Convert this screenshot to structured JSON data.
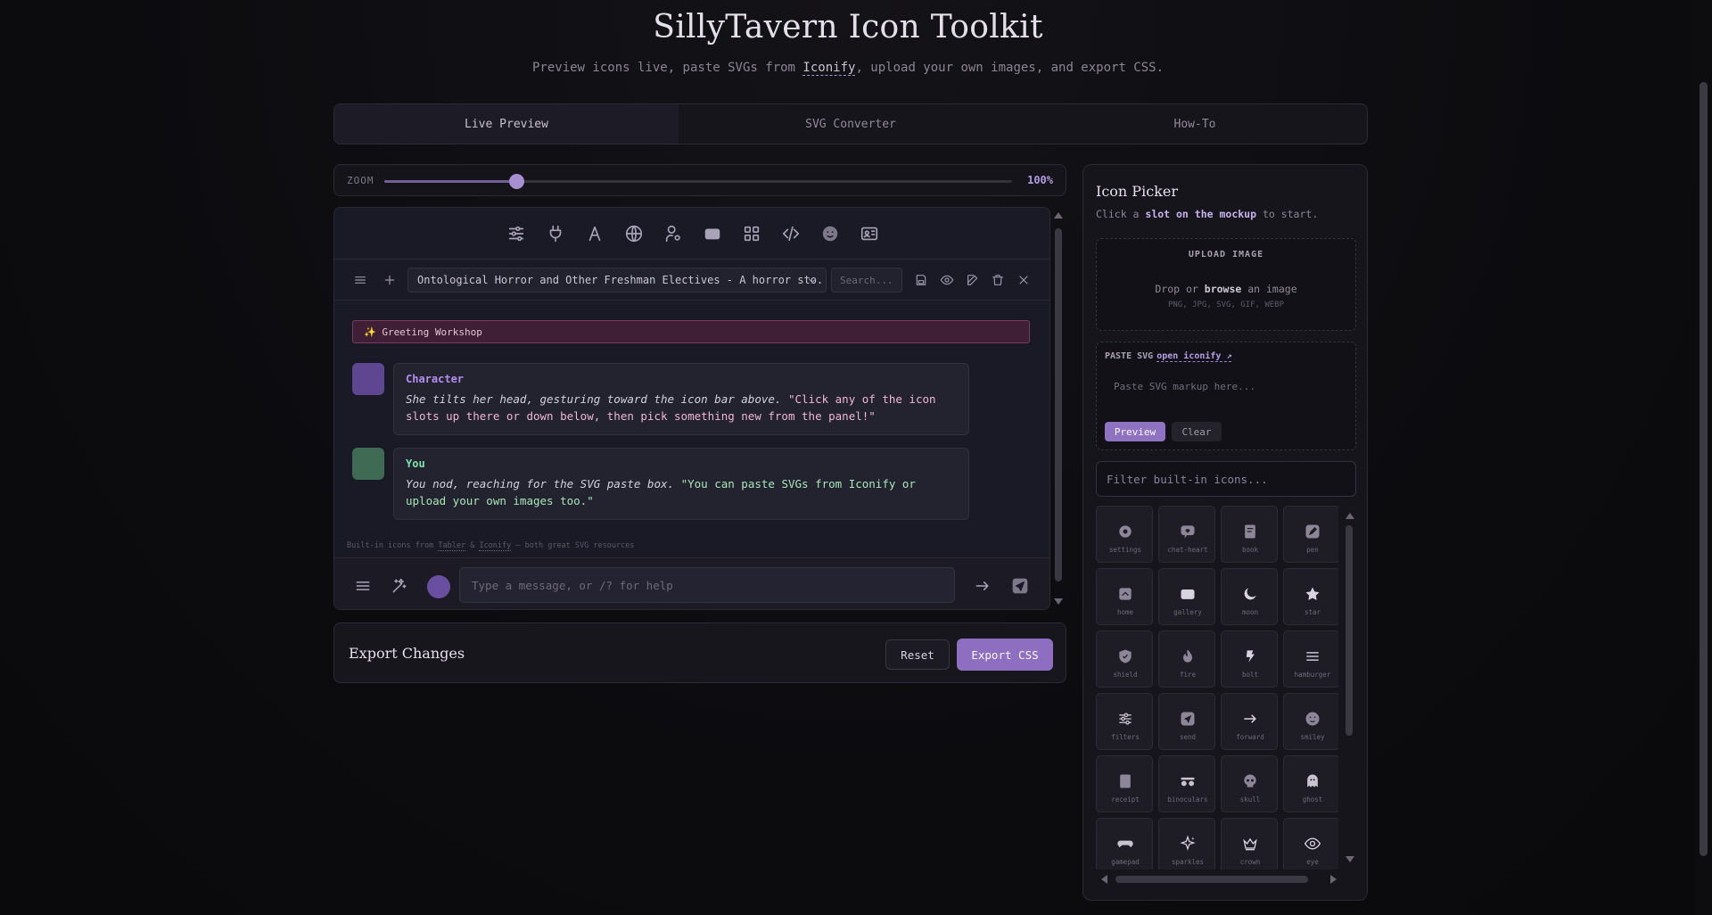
{
  "header": {
    "title": "SillyTavern Icon Toolkit",
    "subtitle_pre": "Preview icons live, paste SVGs from ",
    "subtitle_link": "Iconify",
    "subtitle_post": ", upload your own images, and export CSS."
  },
  "tabs": [
    {
      "label": "Live Preview",
      "active": true
    },
    {
      "label": "SVG Converter",
      "active": false
    },
    {
      "label": "How-To",
      "active": false
    }
  ],
  "zoom": {
    "label": "ZOOM",
    "value_label": "100%",
    "level": 0.21
  },
  "mockup": {
    "top_icons": [
      "sliders-icon",
      "plug-icon",
      "font-icon",
      "globe-icon",
      "user-cog-icon",
      "gallery-icon",
      "grid-icon",
      "code-icon",
      "smiley-icon",
      "id-card-icon"
    ],
    "chat_title": "Ontological Horror and Other Freshman Electives - A horror sto...",
    "search_placeholder": "Search...",
    "greeting_banner": "✨ Greeting Workshop",
    "messages": [
      {
        "name": "Character",
        "name_color": "#b38ef0",
        "avatar_color": "#5e4790",
        "text_pre": "She tilts her head, gesturing toward the icon bar above. ",
        "quote": "\"Click any of the icon slots up there or down below, then pick something new from the panel!\"",
        "quote_color": "#f0b6d6"
      },
      {
        "name": "You",
        "name_color": "#7de3b1",
        "avatar_color": "#3f6b55",
        "text_pre": "You nod, reaching for the SVG paste box. ",
        "quote": "\"You can paste SVGs from Iconify or upload your own images too.\"",
        "quote_color": "#a9e6b8"
      }
    ],
    "credit": {
      "pre": "Built-in icons from ",
      "link1": "Tabler",
      "mid": " & ",
      "link2": "Iconify",
      "post": " — both great SVG resources"
    },
    "input_placeholder": "Type a message, or /? for help"
  },
  "export": {
    "title": "Export Changes",
    "reset_label": "Reset",
    "export_label": "Export CSS"
  },
  "picker": {
    "title": "Icon Picker",
    "hint_pre": "Click a ",
    "hint_bold": "slot on the mockup",
    "hint_post": " to start.",
    "upload": {
      "title": "UPLOAD IMAGE",
      "drop_pre": "Drop or ",
      "drop_bold": "browse",
      "drop_post": " an image",
      "formats": "PNG, JPG, SVG, GIF, WEBP"
    },
    "paste": {
      "title": "PASTE SVG",
      "link": "open iconify ↗",
      "placeholder": "Paste SVG markup here...",
      "preview_label": "Preview",
      "clear_label": "Clear"
    },
    "filter_placeholder": "Filter built-in icons...",
    "icons": [
      "settings",
      "chat-heart",
      "book",
      "pen",
      "home",
      "gallery",
      "moon",
      "star",
      "shield",
      "fire",
      "bolt",
      "hamburger",
      "filters",
      "send",
      "forward",
      "smiley",
      "receipt",
      "binoculars",
      "skull",
      "ghost",
      "gamepad",
      "sparkles",
      "crown",
      "eye"
    ]
  },
  "colors": {
    "accent": "#8e6ec0",
    "accent_light": "#b39be0",
    "background": "#0c0c0f",
    "panel": "#16151c"
  }
}
